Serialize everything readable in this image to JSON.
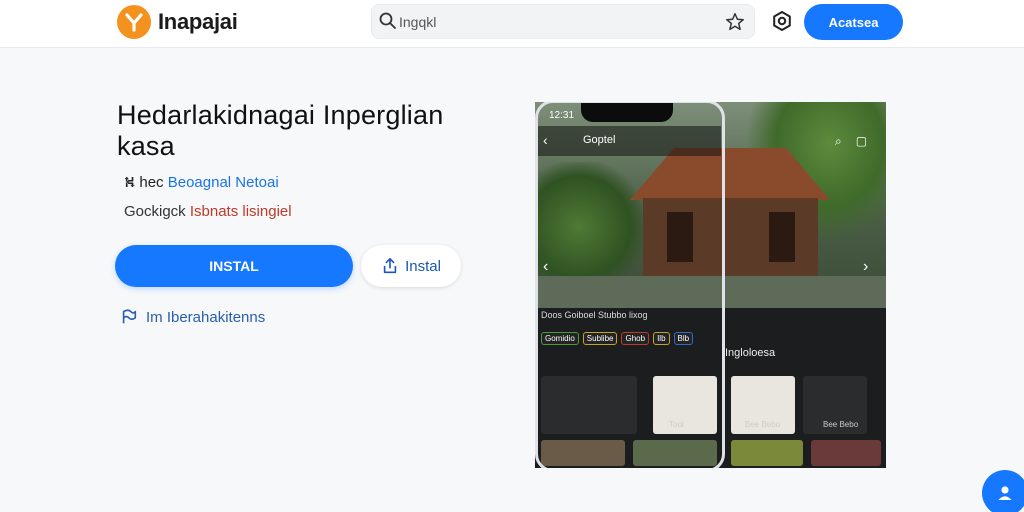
{
  "header": {
    "brand": "Inapajai",
    "search_text": "Ingqkl",
    "cta_label": "Acatsea"
  },
  "app": {
    "title": "Hedarlakidnagai Inperglian kasa",
    "meta1_prefix": "hec",
    "meta1_link": "Beoagnal Netoai",
    "meta2_prefix": "Gockigck",
    "meta2_red": "Isbnats lisingiel",
    "install_label": "INSTAL",
    "secondary_label": "Instal",
    "report_label": "Im Iberahakitenns"
  },
  "screenshot": {
    "time": "12:31",
    "phone_title": "Goptel",
    "tagline": "Doos Goiboel Stubbo lixog",
    "chips": [
      "Gomidio",
      "Sublibe",
      "Ghob",
      "Ilb",
      "Blb"
    ],
    "section_title": "Ingloloesa",
    "tile_labels": [
      "Tool",
      "Bee Bebo",
      "Bee Bebo"
    ]
  },
  "colors": {
    "primary": "#1677ff",
    "logo": "#f4921f"
  }
}
